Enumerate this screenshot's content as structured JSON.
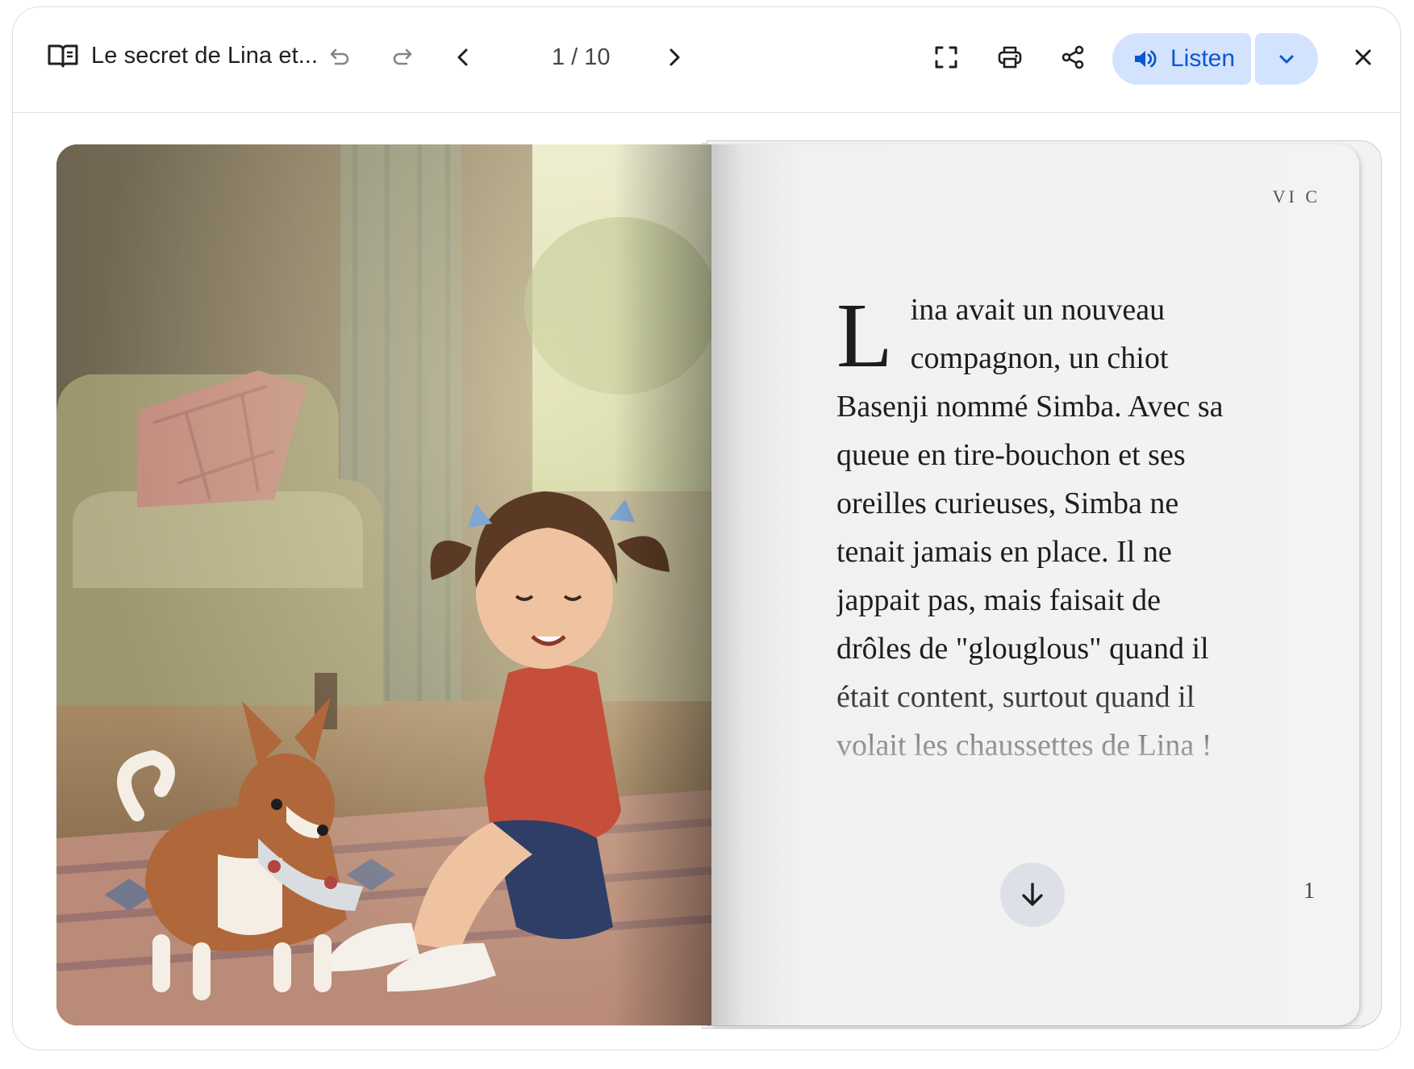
{
  "toolbar": {
    "title": "Le secret de Lina et...",
    "page_indicator": "1 / 10",
    "listen_label": "Listen",
    "icons": {
      "book": "open-book-icon",
      "undo": "undo-icon",
      "redo": "redo-icon",
      "prev": "chevron-left-icon",
      "next": "chevron-right-icon",
      "fullscreen": "fullscreen-icon",
      "print": "print-icon",
      "share": "share-icon",
      "listen": "volume-icon",
      "dropdown": "chevron-down-icon",
      "close": "close-icon"
    }
  },
  "page": {
    "chapter_label": "VI C",
    "drop_cap": "L",
    "text": "ina avait un nouveau compagnon, un chiot Basenji nommé Simba. Avec sa queue en tire-bouchon et ses oreilles curieuses, Simba ne tenait jamais en place. Il ne jappait pas, mais faisait de drôles de \"glouglous\" quand il était content, surtout quand il volait les chaussettes de Lina !",
    "page_number": "1"
  },
  "colors": {
    "accent_bg": "#d3e3fd",
    "accent_text": "#0b57d0",
    "icon": "#444746"
  }
}
